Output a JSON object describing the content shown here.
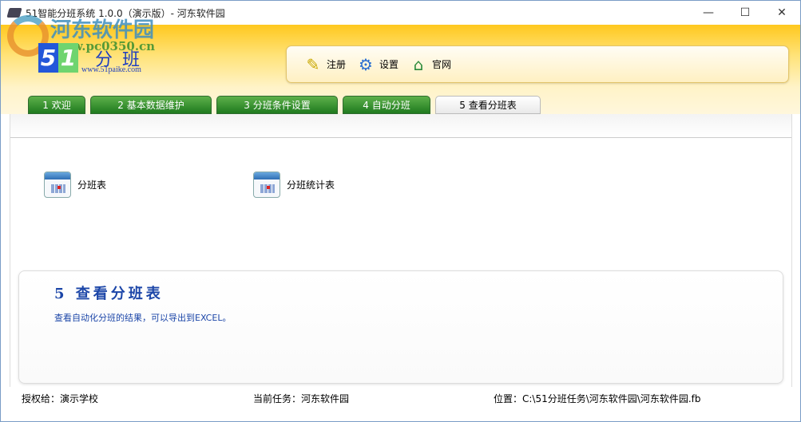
{
  "window": {
    "title": "51智能分班系统 1.0.0（演示版）- 河东软件园",
    "minimize": "—",
    "maximize": "☐",
    "close": "✕"
  },
  "watermark": {
    "name": "河东软件园",
    "url": "www.pc0350.cn"
  },
  "logo": {
    "digit1": "5",
    "digit2": "1",
    "text": "分班",
    "url": "www.51paike.com"
  },
  "toolbar": [
    {
      "label": "注册",
      "icon": "register-icon"
    },
    {
      "label": "设置",
      "icon": "gear-icon"
    },
    {
      "label": "官网",
      "icon": "home-globe-icon"
    }
  ],
  "tabs": [
    {
      "label": "1 欢迎"
    },
    {
      "label": "2 基本数据维护"
    },
    {
      "label": "3 分班条件设置"
    },
    {
      "label": "4 自动分班"
    },
    {
      "label": "5 查看分班表",
      "active": true
    }
  ],
  "links": [
    {
      "label": "分班表"
    },
    {
      "label": "分班统计表"
    }
  ],
  "info": {
    "title": "5  查看分班表",
    "desc": "查看自动化分班的结果，可以导出到EXCEL。"
  },
  "status": {
    "license": "授权给：演示学校",
    "task": "当前任务：河东软件园",
    "location": "位置：C:\\51分班任务\\河东软件园\\河东软件园.fb"
  }
}
